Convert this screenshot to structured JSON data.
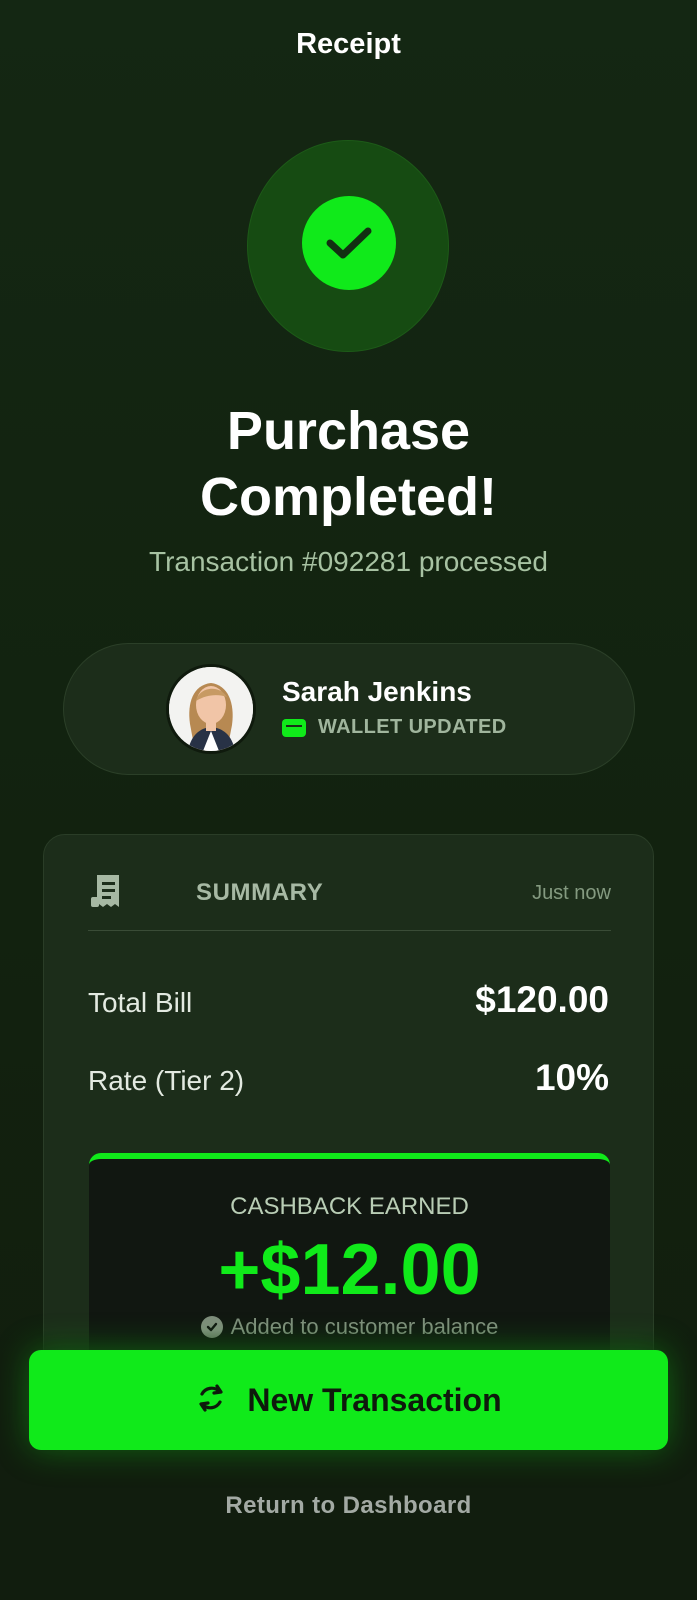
{
  "header": {
    "title": "Receipt"
  },
  "status": {
    "icon": "check-icon",
    "title_line1": "Purchase",
    "title_line2": "Completed!",
    "subtitle": "Transaction #092281 processed"
  },
  "customer": {
    "name": "Sarah Jenkins",
    "avatar_icon": "avatar",
    "wallet_icon": "wallet-icon",
    "wallet_status": "WALLET UPDATED"
  },
  "summary": {
    "icon": "receipt-icon",
    "title": "SUMMARY",
    "time": "Just now",
    "total_bill_label": "Total Bill",
    "total_bill_value": "$120.00",
    "rate_label": "Rate (Tier 2)",
    "rate_value": "10%"
  },
  "cashback": {
    "label": "CASHBACK EARNED",
    "value": "+$12.00",
    "note": "Added to customer balance",
    "note_icon": "check-circle-icon"
  },
  "actions": {
    "primary_icon": "refresh-icon",
    "primary_label": "New Transaction",
    "secondary_label": "Return to Dashboard"
  },
  "colors": {
    "background": "#12200f",
    "card": "#1c2d1a",
    "accent": "#10ea1a",
    "muted_text": "#a7c2a2"
  }
}
